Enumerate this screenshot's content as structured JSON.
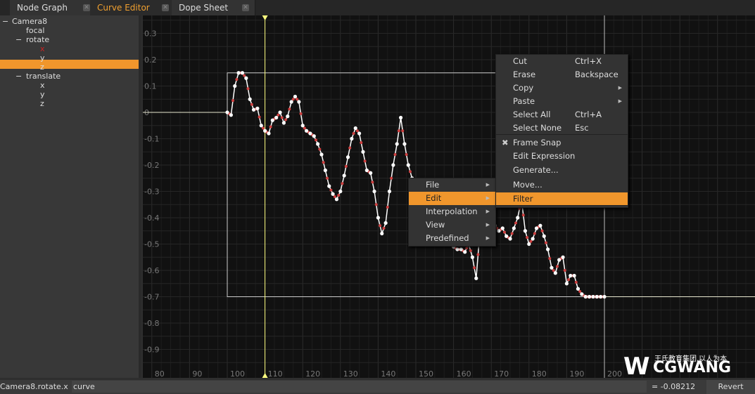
{
  "tabs": [
    {
      "label": "Node Graph"
    },
    {
      "label": "Curve Editor",
      "active": true
    },
    {
      "label": "Dope Sheet"
    }
  ],
  "tree": {
    "root": "Camera8",
    "items": [
      "focal",
      "rotate",
      "x",
      "y",
      "z",
      "translate",
      "x",
      "y",
      "z"
    ],
    "selected": "rotate.x"
  },
  "graph": {
    "y_ticks": [
      "0.3",
      "0.2",
      "0.1",
      "0",
      "-0.1",
      "-0.2",
      "-0.3",
      "-0.4",
      "-0.5",
      "-0.6",
      "-0.7",
      "-0.8",
      "-0.9"
    ],
    "x_ticks": [
      "80",
      "90",
      "100",
      "110",
      "120",
      "130",
      "140",
      "150",
      "160",
      "170",
      "180",
      "190",
      "200"
    ],
    "current_frame": 110,
    "curve_start_frame": 100,
    "curve_values": [
      0,
      -0.01,
      0.1,
      0.15,
      0.15,
      0.13,
      0.05,
      0.01,
      0.015,
      -0.05,
      -0.07,
      -0.08,
      -0.03,
      -0.02,
      0,
      -0.04,
      -0.015,
      0.04,
      0.06,
      0.04,
      -0.05,
      -0.07,
      -0.08,
      -0.09,
      -0.12,
      -0.16,
      -0.22,
      -0.28,
      -0.31,
      -0.33,
      -0.3,
      -0.24,
      -0.17,
      -0.1,
      -0.06,
      -0.08,
      -0.15,
      -0.22,
      -0.23,
      -0.3,
      -0.4,
      -0.46,
      -0.42,
      -0.3,
      -0.2,
      -0.12,
      -0.02,
      -0.12,
      -0.2,
      -0.25,
      -0.32,
      -0.38,
      -0.42,
      -0.35,
      -0.3,
      -0.35,
      -0.42,
      -0.48,
      -0.5,
      -0.5,
      -0.51,
      -0.52,
      -0.52,
      -0.53,
      -0.5,
      -0.55,
      -0.63,
      -0.45,
      -0.44,
      -0.42,
      -0.41,
      -0.43,
      -0.45,
      -0.44,
      -0.47,
      -0.48,
      -0.44,
      -0.4,
      -0.33,
      -0.45,
      -0.5,
      -0.48,
      -0.44,
      -0.43,
      -0.47,
      -0.52,
      -0.59,
      -0.61,
      -0.56,
      -0.55,
      -0.65,
      -0.62,
      -0.62,
      -0.67,
      -0.69,
      -0.7,
      -0.7,
      -0.7,
      -0.7,
      -0.7,
      -0.7
    ],
    "colors": {
      "curve": "#ffffff",
      "keys_red": "#d04040",
      "current_frame": "#ffff80",
      "background": "#111111"
    }
  },
  "context_menu": {
    "items": [
      {
        "label": "File"
      },
      {
        "label": "Edit",
        "highlighted": true
      },
      {
        "label": "Interpolation"
      },
      {
        "label": "View"
      },
      {
        "label": "Predefined"
      }
    ]
  },
  "edit_submenu": {
    "items": [
      {
        "label": "Cut",
        "shortcut": "Ctrl+X"
      },
      {
        "label": "Erase",
        "shortcut": "Backspace"
      },
      {
        "label": "Copy",
        "shortcut": ""
      },
      {
        "label": "Paste",
        "shortcut": ""
      },
      {
        "label": "Select All",
        "shortcut": "Ctrl+A"
      },
      {
        "label": "Select None",
        "shortcut": "Esc"
      },
      {
        "label": "Frame Snap",
        "checked": true
      },
      {
        "label": "Edit Expression"
      },
      {
        "label": "Generate..."
      },
      {
        "label": "Move..."
      },
      {
        "label": "Filter",
        "highlighted": true
      }
    ]
  },
  "bottom": {
    "curve_name": "Camera8.rotate.x",
    "expression": "curve",
    "value": "= -0.08212",
    "revert": "Revert"
  },
  "watermark": {
    "text": "王氏教育集团,以人为本",
    "brand": "CGWANG",
    ".com": ".com"
  }
}
